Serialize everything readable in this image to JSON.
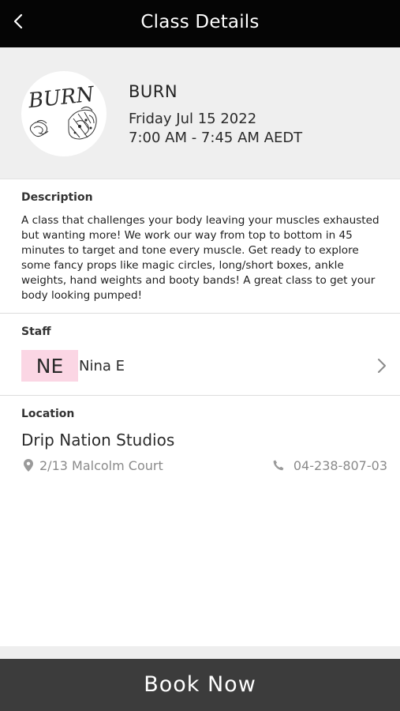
{
  "header": {
    "title": "Class Details",
    "back_icon": "chevron-left-icon"
  },
  "class": {
    "logo_text": "BURN",
    "name": "BURN",
    "date": "Friday Jul 15 2022",
    "time": "7:00 AM - 7:45 AM AEDT"
  },
  "description": {
    "label": "Description",
    "text": "A class that challenges your body leaving your muscles exhausted but wanting more! We work our way from top to bottom in 45 minutes to target and tone every muscle. Get ready to explore some fancy props like magic circles, long/short boxes, ankle weights, hand weights and booty bands! A great class to get your body looking pumped!"
  },
  "staff": {
    "label": "Staff",
    "initials": "NE",
    "name": "Nina E",
    "initials_bg": "#fbd6e4",
    "chevron_icon": "chevron-right-icon"
  },
  "location": {
    "label": "Location",
    "studio": "Drip Nation Studios",
    "address": "2/13 Malcolm Court",
    "address_icon": "map-pin-icon",
    "phone": "04-238-807-03",
    "phone_icon": "phone-icon"
  },
  "footer": {
    "book_label": "Book Now"
  },
  "colors": {
    "header_bg": "#050505",
    "summary_bg": "#efefef",
    "book_bg": "#3c3c3c",
    "muted_text": "#8a8a8a"
  }
}
